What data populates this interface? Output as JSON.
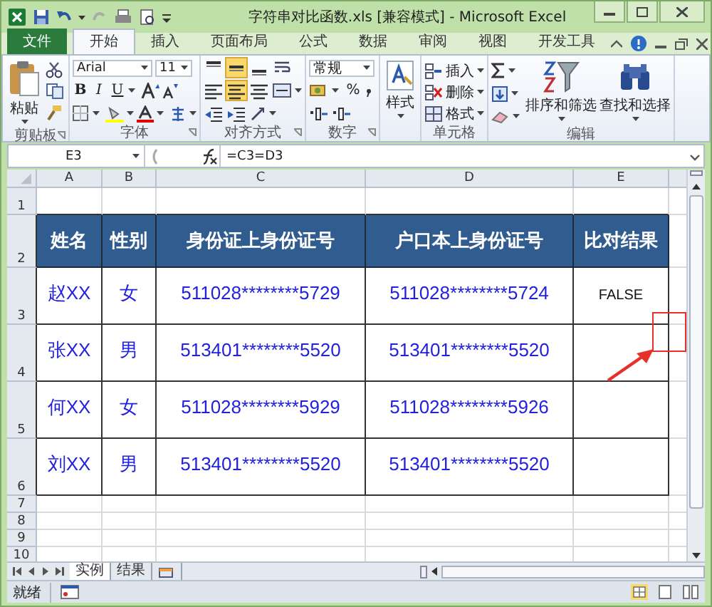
{
  "window": {
    "title": "字符串对比函数.xls [兼容模式] - Microsoft Excel"
  },
  "ribbon_tabs": [
    {
      "label": "文件",
      "kind": "file",
      "selected": false
    },
    {
      "label": "开始",
      "kind": "tab",
      "selected": true
    },
    {
      "label": "插入",
      "kind": "tab",
      "selected": false
    },
    {
      "label": "页面布局",
      "kind": "tab",
      "selected": false
    },
    {
      "label": "公式",
      "kind": "tab",
      "selected": false
    },
    {
      "label": "数据",
      "kind": "tab",
      "selected": false
    },
    {
      "label": "审阅",
      "kind": "tab",
      "selected": false
    },
    {
      "label": "视图",
      "kind": "tab",
      "selected": false
    },
    {
      "label": "开发工具",
      "kind": "tab",
      "selected": false
    }
  ],
  "ribbon_groups": [
    {
      "kind": "clipboard",
      "label": "剪贴板",
      "paste": "粘贴"
    },
    {
      "kind": "font",
      "label": "字体",
      "font_name": "Arial",
      "font_size": "11",
      "styles": [
        "B",
        "I",
        "U"
      ]
    },
    {
      "kind": "alignment",
      "label": "对齐方式",
      "vertical": [
        {
          "selected": false
        },
        {
          "selected": true
        },
        {
          "selected": false
        }
      ],
      "horizontal": [
        {
          "selected": false
        },
        {
          "selected": true
        },
        {
          "selected": false
        }
      ]
    },
    {
      "kind": "number",
      "label": "数字",
      "format": "常规",
      "percent": "%"
    },
    {
      "kind": "styles",
      "button": "样式"
    },
    {
      "kind": "cells",
      "label": "单元格",
      "items": [
        "插入",
        "删除",
        "格式"
      ]
    },
    {
      "kind": "editing",
      "label": "编辑",
      "items": [
        "排序和筛选",
        "查找和选择"
      ]
    }
  ],
  "formula_bar": {
    "name_box": "E3",
    "formula": "=C3=D3"
  },
  "sheet": {
    "column_headers": [
      "A",
      "B",
      "C",
      "D",
      "E"
    ],
    "row_numbers": [
      "1",
      "2",
      "3",
      "4",
      "5",
      "6",
      "7",
      "8",
      "9",
      "10"
    ],
    "header_cells": [
      "姓名",
      "性别",
      "身份证上身份证号",
      "户口本上身份证号",
      "比对结果"
    ],
    "data_rows": [
      {
        "name": "赵XX",
        "gender": "女",
        "id_card": "511028********5729",
        "household": "511028********5724",
        "result": "FALSE"
      },
      {
        "name": "张XX",
        "gender": "男",
        "id_card": "513401********5520",
        "household": "513401********5520"
      },
      {
        "name": "何XX",
        "gender": "女",
        "id_card": "511028********5929",
        "household": "511028********5926"
      },
      {
        "name": "刘XX",
        "gender": "男",
        "id_card": "513401********5520",
        "household": "513401********5520"
      }
    ]
  },
  "sheet_tabs": [
    {
      "label": "实例",
      "selected": true
    },
    {
      "label": "结果",
      "selected": false
    }
  ],
  "status_bar": {
    "text": "就绪"
  }
}
